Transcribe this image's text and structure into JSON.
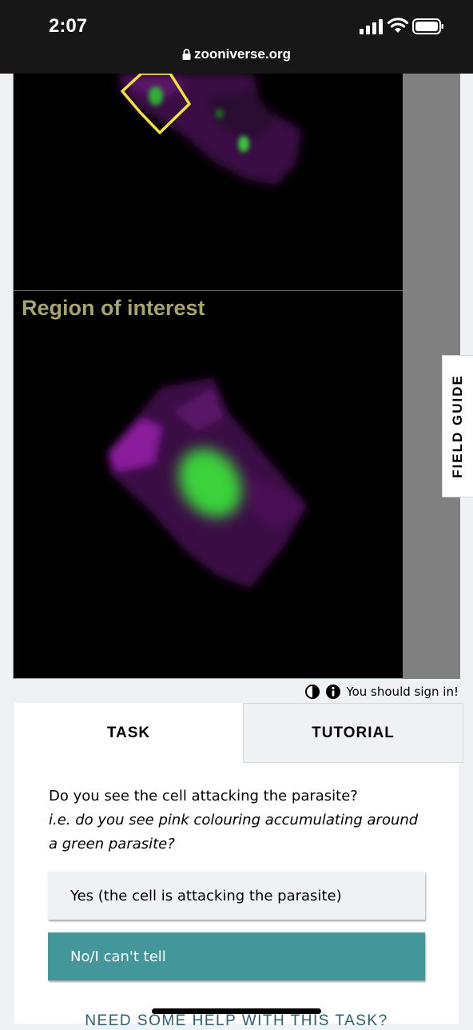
{
  "status_bar": {
    "time": "2:07",
    "url": "zooniverse.org"
  },
  "viewer": {
    "region_label": "Region of interest",
    "field_guide_label": "FIELD GUIDE",
    "highlight_color": "#f2e33c",
    "cell_color": "#8a1a9c",
    "parasite_color": "#3fd63a"
  },
  "meta": {
    "sign_in_text": "You should sign in!",
    "icons": [
      "contrast-icon",
      "info-icon"
    ]
  },
  "tabs": [
    {
      "label": "TASK",
      "active": true
    },
    {
      "label": "TUTORIAL",
      "active": false
    }
  ],
  "task": {
    "question": "Do you see the cell attacking the parasite?",
    "hint": "i.e. do you see pink colouring accumulating around a green parasite?",
    "answers": [
      {
        "label": "Yes (the cell is attacking the parasite)",
        "selected": false
      },
      {
        "label": "No/I can't tell",
        "selected": true
      }
    ],
    "help_link": "NEED SOME HELP WITH THIS TASK?"
  },
  "colors": {
    "accent": "#43969a",
    "link": "#2b5f6e",
    "panel_bg": "#eff2f5"
  }
}
